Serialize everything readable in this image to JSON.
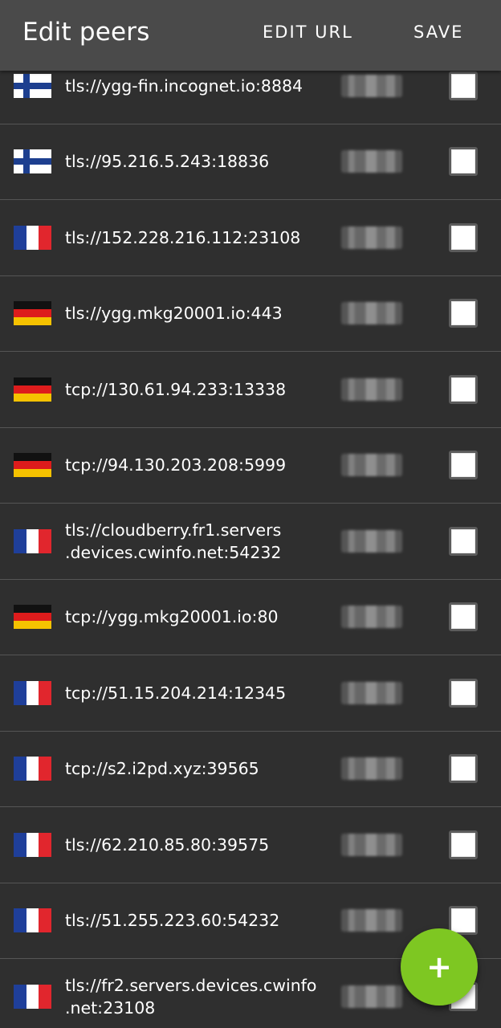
{
  "appbar": {
    "title": "Edit peers",
    "edit_url_label": "EDIT URL",
    "save_label": "SAVE"
  },
  "colors": {
    "appbar_bg": "#4a4a4a",
    "list_bg": "#2f2f2f",
    "fab_bg": "#7ec722"
  },
  "fab": {
    "icon": "plus-icon",
    "glyph": "+"
  },
  "peers": [
    {
      "country": "FI",
      "address": "tls://ygg-fin.incognet.io:8884",
      "checked": false
    },
    {
      "country": "FI",
      "address": "tls://95.216.5.243:18836",
      "checked": false
    },
    {
      "country": "FR",
      "address": "tls://152.228.216.112:23108",
      "checked": false
    },
    {
      "country": "DE",
      "address": "tls://ygg.mkg20001.io:443",
      "checked": false
    },
    {
      "country": "DE",
      "address": "tcp://130.61.94.233:13338",
      "checked": false
    },
    {
      "country": "DE",
      "address": "tcp://94.130.203.208:5999",
      "checked": false
    },
    {
      "country": "FR",
      "address": "tls://cloudberry.fr1.servers\n.devices.cwinfo.net:54232",
      "checked": false
    },
    {
      "country": "DE",
      "address": "tcp://ygg.mkg20001.io:80",
      "checked": false
    },
    {
      "country": "FR",
      "address": "tcp://51.15.204.214:12345",
      "checked": false
    },
    {
      "country": "FR",
      "address": "tcp://s2.i2pd.xyz:39565",
      "checked": false
    },
    {
      "country": "FR",
      "address": "tls://62.210.85.80:39575",
      "checked": false
    },
    {
      "country": "FR",
      "address": "tls://51.255.223.60:54232",
      "checked": false
    },
    {
      "country": "FR",
      "address": "tls://fr2.servers.devices.cwinfo\n.net:23108",
      "checked": false
    }
  ]
}
